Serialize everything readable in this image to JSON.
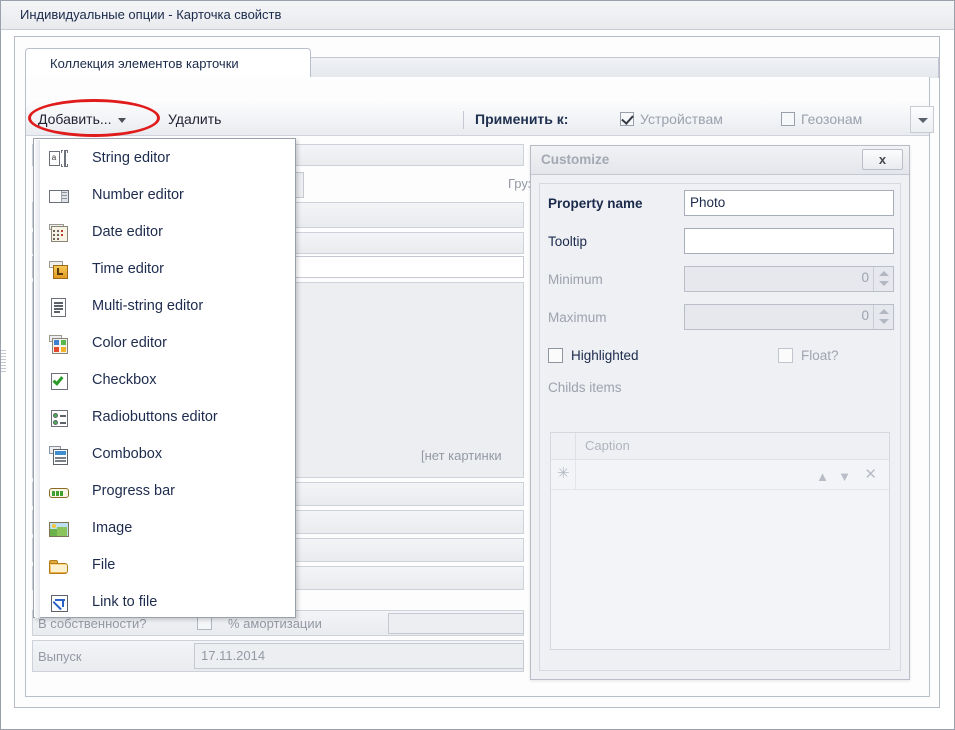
{
  "window": {
    "title": "Индивидуальные опции - Карточка свойств"
  },
  "tabs": [
    {
      "label": "Коллекция элементов карточки",
      "active": true
    }
  ],
  "toolbar": {
    "add_label": "Добавить...",
    "delete_label": "Удалить",
    "apply_to_label": "Применить к:",
    "devices_label": "Устройствам",
    "devices_checked": true,
    "geozones_label": "Геозонам",
    "geozones_checked": false,
    "overflow_icon": "chevron-down-icon"
  },
  "add_menu": {
    "items": [
      {
        "label": "String editor",
        "icon": "string-editor-icon"
      },
      {
        "label": "Number editor",
        "icon": "number-editor-icon"
      },
      {
        "label": "Date editor",
        "icon": "date-editor-icon"
      },
      {
        "label": "Time editor",
        "icon": "time-editor-icon"
      },
      {
        "label": "Multi-string editor",
        "icon": "multistring-editor-icon"
      },
      {
        "label": "Color editor",
        "icon": "color-editor-icon"
      },
      {
        "label": "Checkbox",
        "icon": "checkbox-icon"
      },
      {
        "label": "Radiobuttons editor",
        "icon": "radiobuttons-icon"
      },
      {
        "label": "Combobox",
        "icon": "combobox-icon"
      },
      {
        "label": "Progress bar",
        "icon": "progressbar-icon"
      },
      {
        "label": "Image",
        "icon": "image-icon"
      },
      {
        "label": "File",
        "icon": "folder-icon"
      },
      {
        "label": "Link to file",
        "icon": "link-to-file-icon"
      }
    ]
  },
  "customize_panel": {
    "title": "Customize",
    "close_label": "x",
    "property_name_label": "Property name",
    "property_name_value": "Photo",
    "tooltip_label": "Tooltip",
    "tooltip_value": "",
    "minimum_label": "Minimum",
    "minimum_value": "0",
    "maximum_label": "Maximum",
    "maximum_value": "0",
    "highlighted_label": "Highlighted",
    "highlighted_checked": false,
    "float_label": "Float?",
    "float_checked": false,
    "childs_items_label": "Childs items",
    "grid": {
      "columns": [
        "Caption"
      ],
      "rows": [],
      "new_row_marker": "✳",
      "row_up_icon": "triangle-up-icon",
      "row_down_icon": "triangle-down-icon",
      "row_delete_icon": "close-x-icon"
    }
  },
  "background_form": {
    "cargo_text": "Грузо",
    "no_image_text": "[нет картинки",
    "ownership_label": "В собственности?",
    "depreciation_label": "% амортизации",
    "release_label": "Выпуск",
    "release_value": "17.11.2014"
  },
  "annotation": {
    "shape": "red-ellipse",
    "color": "#e01b1b",
    "targets": "add-button"
  }
}
